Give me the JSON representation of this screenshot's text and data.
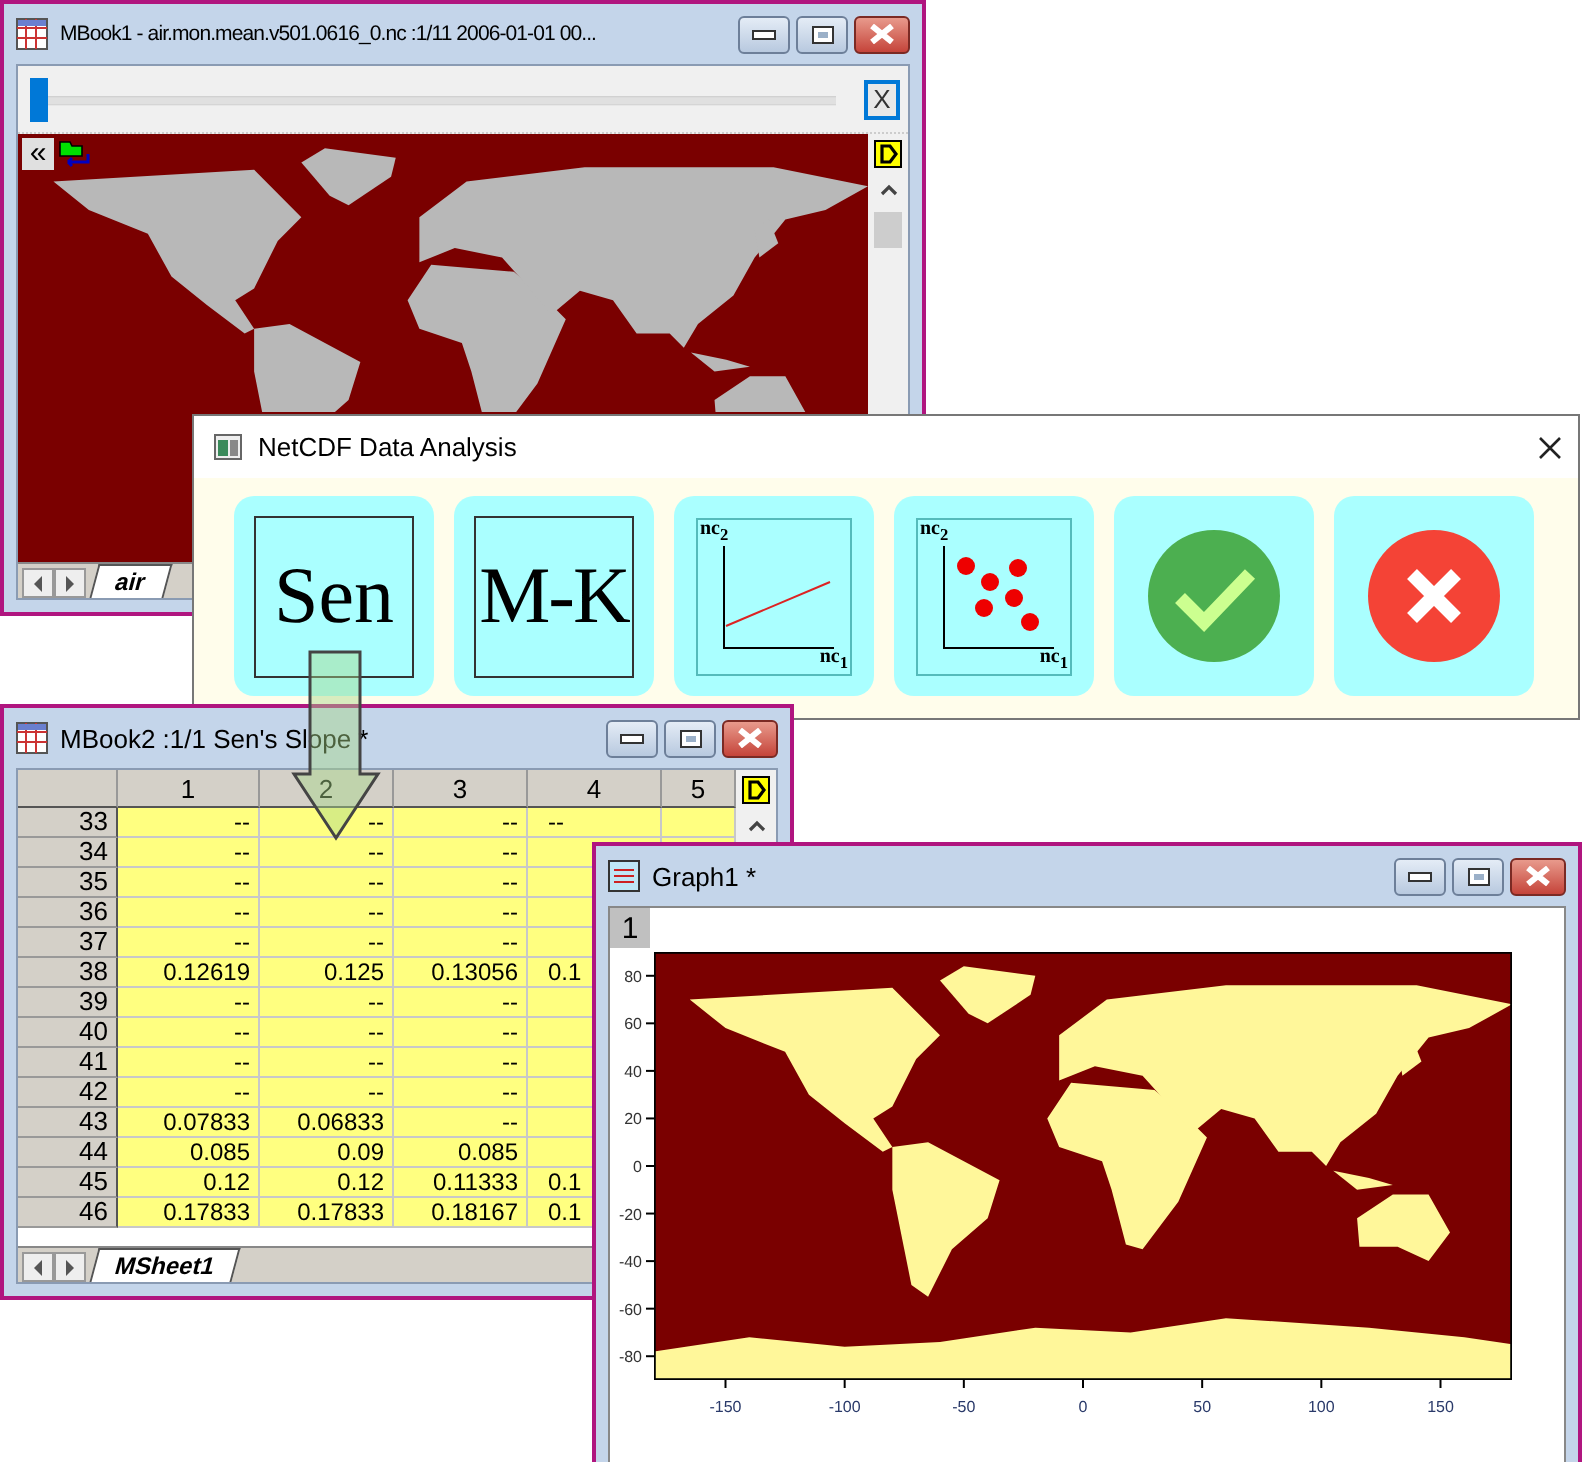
{
  "mbook1": {
    "title": "MBook1 - air.mon.mean.v501.0616_0.nc :1/11 2006-01-01 00...",
    "slider": {
      "level": 0
    },
    "close_label": "X",
    "collapse_label": "«",
    "sheet_tabs": [
      {
        "label": "air",
        "selected": true
      }
    ]
  },
  "dialog": {
    "title": "NetCDF Data Analysis",
    "buttons": [
      {
        "kind": "text",
        "label": "Sen"
      },
      {
        "kind": "text",
        "label": "M-K"
      },
      {
        "kind": "line-plot",
        "x_label": "nc$_{1}$",
        "y_label": "nc$_{2}$"
      },
      {
        "kind": "scatter-plot",
        "x_label": "nc$_{1}$",
        "y_label": "nc$_{2}$"
      },
      {
        "kind": "ok"
      },
      {
        "kind": "cancel"
      }
    ]
  },
  "mbook2": {
    "title": "MBook2 :1/1 Sen's Slope *",
    "columns": [
      "1",
      "2",
      "3",
      "4",
      "5"
    ],
    "rows": [
      {
        "row": "33",
        "cells": [
          "--",
          "--",
          "--",
          "--"
        ]
      },
      {
        "row": "34",
        "cells": [
          "--",
          "--",
          "--"
        ]
      },
      {
        "row": "35",
        "cells": [
          "--",
          "--",
          "--"
        ]
      },
      {
        "row": "36",
        "cells": [
          "--",
          "--",
          "--"
        ]
      },
      {
        "row": "37",
        "cells": [
          "--",
          "--",
          "--"
        ]
      },
      {
        "row": "38",
        "cells": [
          "0.12619",
          "0.125",
          "0.13056",
          "0.1"
        ]
      },
      {
        "row": "39",
        "cells": [
          "--",
          "--",
          "--"
        ]
      },
      {
        "row": "40",
        "cells": [
          "--",
          "--",
          "--"
        ]
      },
      {
        "row": "41",
        "cells": [
          "--",
          "--",
          "--"
        ]
      },
      {
        "row": "42",
        "cells": [
          "--",
          "--",
          "--"
        ]
      },
      {
        "row": "43",
        "cells": [
          "0.07833",
          "0.06833",
          "--"
        ]
      },
      {
        "row": "44",
        "cells": [
          "0.085",
          "0.09",
          "0.085"
        ]
      },
      {
        "row": "45",
        "cells": [
          "0.12",
          "0.12",
          "0.11333",
          "0.1"
        ]
      },
      {
        "row": "46",
        "cells": [
          "0.17833",
          "0.17833",
          "0.18167",
          "0.1"
        ]
      }
    ],
    "sheet_tabs": [
      {
        "label": "MSheet1",
        "selected": true
      }
    ]
  },
  "graph1": {
    "title": "Graph1 *",
    "layer": "1",
    "y_tick_labels": [
      "80",
      "60",
      "40",
      "20",
      "0",
      "-20",
      "-40",
      "-60",
      "-80"
    ],
    "x_tick_labels": [
      "-150",
      "-100",
      "-50",
      "0",
      "50",
      "100",
      "150"
    ]
  }
}
